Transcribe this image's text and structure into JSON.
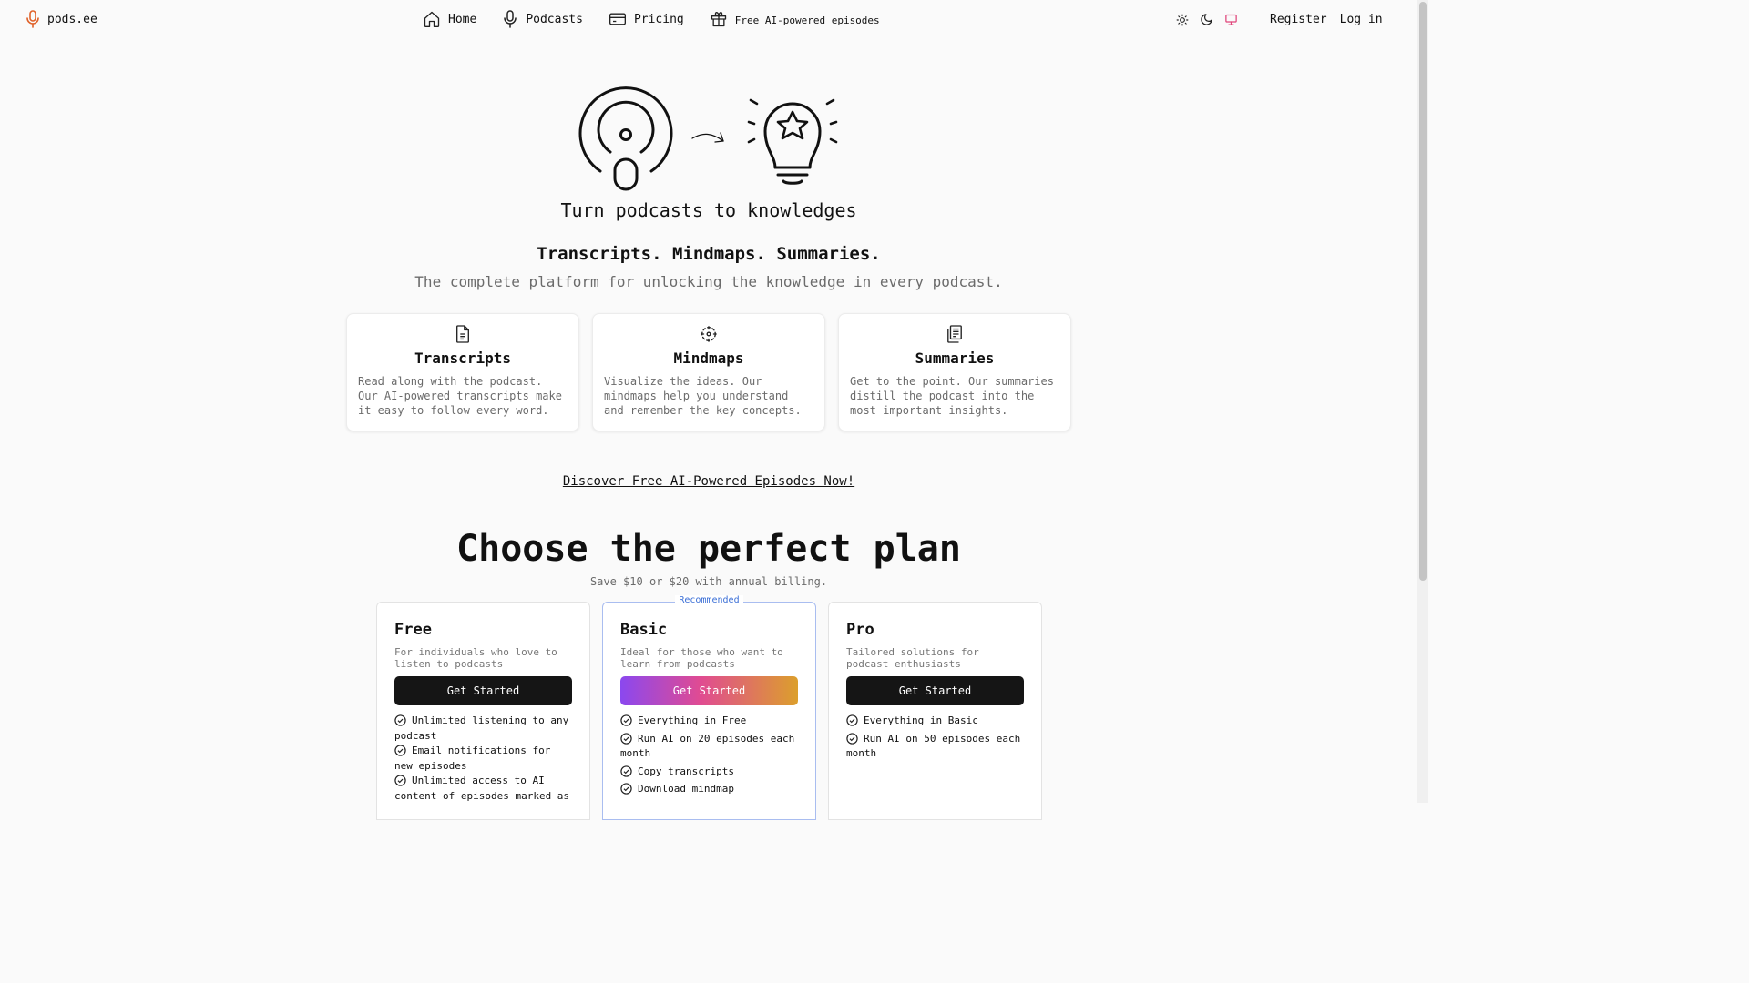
{
  "brand": {
    "name": "pods.ee",
    "accent": "#e0622a"
  },
  "nav": [
    {
      "label": "Home",
      "icon": "home-icon"
    },
    {
      "label": "Podcasts",
      "icon": "microphone-icon"
    },
    {
      "label": "Pricing",
      "icon": "credit-card-icon"
    },
    {
      "label": "Free AI-powered episodes",
      "icon": "gift-icon"
    }
  ],
  "theme_toggle": [
    "sun-icon",
    "moon-icon",
    "monitor-icon"
  ],
  "auth": {
    "register": "Register",
    "login": "Log in"
  },
  "hero": {
    "title": "Turn podcasts to knowledges",
    "tagline": "Transcripts. Mindmaps. Summaries.",
    "subtitle": "The complete platform for unlocking the knowledge in every podcast."
  },
  "features": [
    {
      "title": "Transcripts",
      "icon": "document-icon",
      "text": "Read along with the podcast. Our AI-powered transcripts make it easy to follow every word."
    },
    {
      "title": "Mindmaps",
      "icon": "mindmap-icon",
      "text": "Visualize the ideas. Our mindmaps help you understand and remember the key concepts."
    },
    {
      "title": "Summaries",
      "icon": "clipboard-icon",
      "text": "Get to the point. Our summaries distill the podcast into the most important insights."
    }
  ],
  "discover_link": "Discover Free AI-Powered Episodes Now!",
  "pricing": {
    "title": "Choose the perfect plan",
    "subtitle": "Save $10 or $20 with annual billing.",
    "recommended_label": "Recommended",
    "plans": [
      {
        "name": "Free",
        "desc": "For individuals who love to listen to podcasts",
        "cta": "Get Started",
        "features": [
          "Unlimited listening to any podcast",
          "Email notifications for new episodes",
          "Unlimited access to AI content of episodes marked as"
        ]
      },
      {
        "name": "Basic",
        "desc": "Ideal for those who want to learn from podcasts",
        "cta": "Get Started",
        "features": [
          "Everything in Free",
          "Run AI on 20 episodes each month",
          "Copy transcripts",
          "Download mindmap"
        ]
      },
      {
        "name": "Pro",
        "desc": "Tailored solutions for podcast enthusiasts",
        "cta": "Get Started",
        "features": [
          "Everything in Basic",
          "Run AI on 50 episodes each month"
        ]
      }
    ]
  }
}
